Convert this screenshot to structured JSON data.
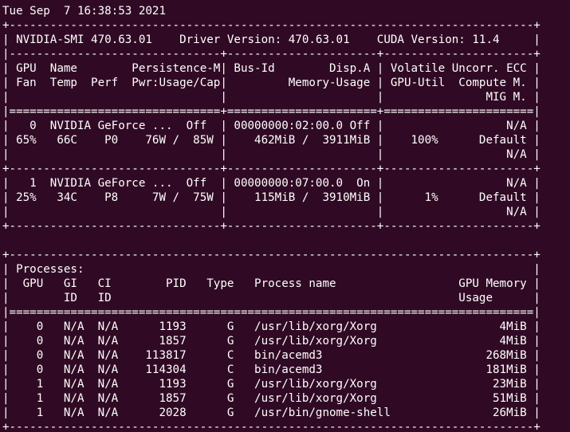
{
  "window": {
    "background": "#300a24",
    "foreground": "#ffffff"
  },
  "terminal": {
    "lines": [
      "Tue Sep  7 16:38:53 2021",
      "+-----------------------------------------------------------------------------+",
      "| NVIDIA-SMI 470.63.01    Driver Version: 470.63.01    CUDA Version: 11.4     |",
      "|-------------------------------+----------------------+----------------------+",
      "| GPU  Name        Persistence-M| Bus-Id        Disp.A | Volatile Uncorr. ECC |",
      "| Fan  Temp  Perf  Pwr:Usage/Cap|         Memory-Usage | GPU-Util  Compute M. |",
      "|                               |                      |               MIG M. |",
      "|===============================+======================+======================|",
      "|   0  NVIDIA GeForce ...  Off  | 00000000:02:00.0 Off |                  N/A |",
      "| 65%   66C    P0    76W /  85W |    462MiB /  3911MiB |    100%      Default |",
      "|                               |                      |                  N/A |",
      "+-------------------------------+----------------------+----------------------+",
      "|   1  NVIDIA GeForce ...  Off  | 00000000:07:00.0  On |                  N/A |",
      "| 25%   34C    P8     7W /  75W |    115MiB /  3910MiB |      1%      Default |",
      "|                               |                      |                  N/A |",
      "+-------------------------------+----------------------+----------------------+",
      "",
      "+-----------------------------------------------------------------------------+",
      "| Processes:                                                                  |",
      "|  GPU   GI   CI        PID   Type   Process name                  GPU Memory |",
      "|        ID   ID                                                   Usage      |",
      "|=============================================================================|",
      "|    0   N/A  N/A      1193      G   /usr/lib/xorg/Xorg                  4MiB |",
      "|    0   N/A  N/A      1857      G   /usr/lib/xorg/Xorg                  4MiB |",
      "|    0   N/A  N/A    113817      C   bin/acemd3                        268MiB |",
      "|    0   N/A  N/A    114304      C   bin/acemd3                        181MiB |",
      "|    1   N/A  N/A      1193      G   /usr/lib/xorg/Xorg                 23MiB |",
      "|    1   N/A  N/A      1857      G   /usr/lib/xorg/Xorg                 51MiB |",
      "|    1   N/A  N/A      2028      G   /usr/bin/gnome-shell               26MiB |",
      "+-----------------------------------------------------------------------------+"
    ]
  }
}
